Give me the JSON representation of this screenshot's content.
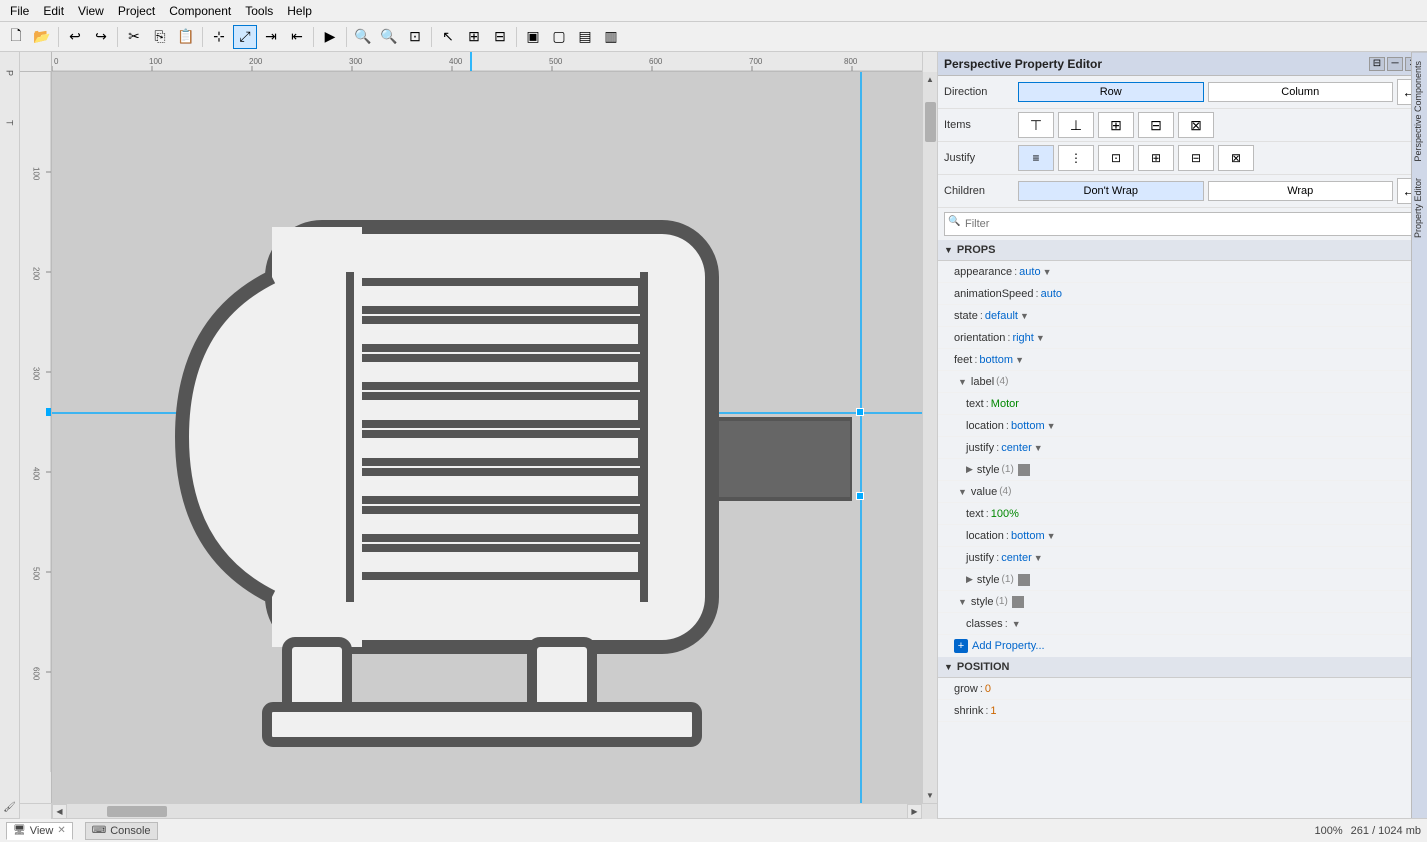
{
  "menuBar": {
    "items": [
      "File",
      "Edit",
      "View",
      "Project",
      "Component",
      "Tools",
      "Help"
    ]
  },
  "toolbar": {
    "groups": [
      [
        "new",
        "open"
      ],
      [
        "undo",
        "redo"
      ],
      [
        "cut",
        "copy",
        "paste"
      ],
      [
        "select",
        "move",
        "route1",
        "route2"
      ],
      [
        "play"
      ],
      [
        "zoom-in",
        "zoom-out",
        "zoom-fit"
      ],
      [
        "pointer",
        "pan1",
        "pan2"
      ],
      [
        "comp1",
        "comp2",
        "comp3",
        "comp4"
      ]
    ]
  },
  "perspectiveEditor": {
    "title": "Perspective Property Editor",
    "direction": {
      "label": "Direction",
      "options": [
        "Row",
        "Column"
      ],
      "active": "Row"
    },
    "items": {
      "label": "Items",
      "buttons": [
        "align-start",
        "align-center",
        "align-end",
        "align-stretch",
        "align-baseline"
      ]
    },
    "justify": {
      "label": "Justify",
      "buttons": [
        "justify-start",
        "justify-center",
        "justify-end",
        "justify-between",
        "justify-around",
        "justify-evenly"
      ],
      "active": 0
    },
    "children": {
      "label": "Children",
      "options": [
        "Don't Wrap",
        "Wrap"
      ],
      "active": "Don't Wrap"
    },
    "filter": {
      "placeholder": "Filter"
    },
    "props": {
      "sectionLabel": "PROPS",
      "items": [
        {
          "key": "appearance",
          "colon": " : ",
          "value": "auto",
          "type": "dropdown",
          "indent": 0
        },
        {
          "key": "animationSpeed",
          "colon": " : ",
          "value": "auto",
          "type": "text",
          "indent": 0
        },
        {
          "key": "state",
          "colon": " : ",
          "value": "default",
          "type": "dropdown",
          "indent": 0
        },
        {
          "key": "orientation",
          "colon": " : ",
          "value": "right",
          "type": "dropdown",
          "indent": 0
        },
        {
          "key": "feet",
          "colon": " : ",
          "value": "bottom",
          "type": "dropdown",
          "indent": 0
        },
        {
          "key": "label",
          "count": "(4)",
          "type": "group",
          "indent": 0,
          "expanded": true
        },
        {
          "key": "text",
          "colon": " : ",
          "value": "Motor",
          "type": "string",
          "indent": 1
        },
        {
          "key": "location",
          "colon": " : ",
          "value": "bottom",
          "type": "dropdown",
          "indent": 1
        },
        {
          "key": "justify",
          "colon": " : ",
          "value": "center",
          "type": "dropdown",
          "indent": 1
        },
        {
          "key": "style",
          "count": "(1)",
          "type": "group-paint",
          "indent": 1,
          "expanded": false
        },
        {
          "key": "value",
          "count": "(4)",
          "type": "group",
          "indent": 0,
          "expanded": true
        },
        {
          "key": "text",
          "colon": " : ",
          "value": "100%",
          "type": "string",
          "indent": 1
        },
        {
          "key": "location",
          "colon": " : ",
          "value": "bottom",
          "type": "dropdown",
          "indent": 1
        },
        {
          "key": "justify",
          "colon": " : ",
          "value": "center",
          "type": "dropdown",
          "indent": 1
        },
        {
          "key": "style",
          "count": "(1)",
          "type": "group-paint",
          "indent": 1,
          "expanded": false
        },
        {
          "key": "style",
          "count": "(1)",
          "type": "group-paint",
          "indent": 0,
          "expanded": true
        },
        {
          "key": "classes",
          "colon": " : ",
          "value": "",
          "type": "dropdown",
          "indent": 1
        },
        {
          "key": "Add Property...",
          "type": "add",
          "indent": 0
        }
      ]
    },
    "position": {
      "sectionLabel": "POSITION",
      "items": [
        {
          "key": "grow",
          "colon": " : ",
          "value": "0",
          "type": "number",
          "indent": 0
        },
        {
          "key": "shrink",
          "colon": " : ",
          "value": "1",
          "type": "number",
          "indent": 0
        }
      ]
    }
  },
  "sidebarTabs": {
    "right1": "Perspective Components",
    "right2": "Property Editor"
  },
  "leftSidebar": {
    "tabs": [
      "Project",
      "Tags"
    ]
  },
  "canvas": {
    "rulerMarks": [
      0,
      100,
      200,
      300,
      400,
      500,
      600,
      700,
      800
    ],
    "rulerMarksV": [
      100,
      200,
      300,
      400,
      500,
      600
    ]
  },
  "statusBar": {
    "zoom": "100%",
    "memory": "261 / 1024 mb"
  },
  "bottomTabs": [
    {
      "label": "View",
      "active": true
    },
    {
      "label": "Console",
      "active": false
    }
  ]
}
